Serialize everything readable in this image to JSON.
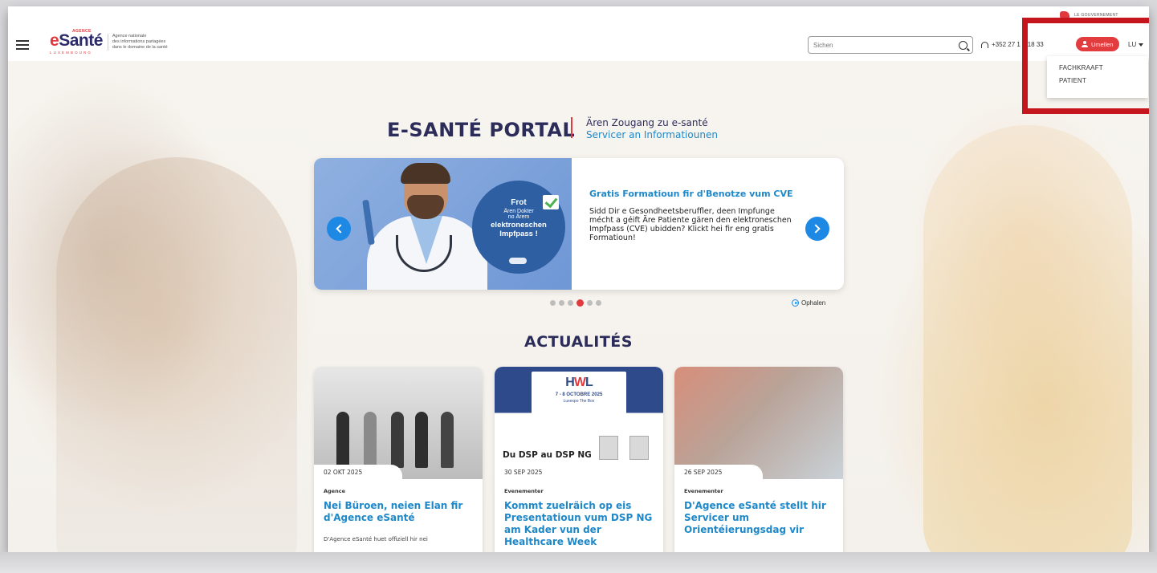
{
  "header": {
    "gov_label": "LE GOUVERNEMENT",
    "logo": {
      "agence": "AGENCE",
      "e": "e",
      "sante": "Santé",
      "country": "LUXEMBOURG",
      "tagline_1": "Agence nationale",
      "tagline_2": "des informations partagées",
      "tagline_3": "dans le domaine de la santé"
    },
    "search_placeholder": "Sichen",
    "phone": "+352 27 1 0 18 33",
    "login_label": "Umellen",
    "language": "LU"
  },
  "login_dropdown": {
    "items": [
      "FACHKRAAFT",
      "PATIENT"
    ]
  },
  "portal": {
    "title": "E-SANTÉ PORTAL",
    "subtitle_1": "Ären Zougang zu e-santé",
    "subtitle_2": "Servicer an Informatiounen"
  },
  "carousel": {
    "badge": {
      "line1": "Frot",
      "line2": "Ären Dokter",
      "line3": "no Ärem",
      "line4": "elektroneschen",
      "line5": "Impfpass !"
    },
    "slide_title": "Gratis Formatioun fir d'Benotze vum CVE",
    "slide_body": "Sidd Dir e Gesondheetsberuffler, deen Impfunge mécht a géift Äre Patiente gären den elektroneschen Impfpass (CVE) ubidden? Klickt hei fir eng gratis Formatioun!",
    "pause_label": "Ophalen",
    "dots_total": 6,
    "active_dot": 4
  },
  "news": {
    "title": "ACTUALITÉS",
    "cards": [
      {
        "date": "02 OKT 2025",
        "category": "Agence",
        "headline": "Nei Büroen, neien Elan fir d'Agence eSanté",
        "excerpt": "D'Agence eSanté huet offiziell hir nei"
      },
      {
        "date": "30 SEP 2025",
        "category": "Evenementer",
        "headline": "Kommt zuelräich op eis Presentatioun vum DSP NG am Kader vun der Healthcare Week",
        "banner": {
          "logo_h": "H",
          "logo_w": "W",
          "logo_l": "L",
          "dates": "7 - 8 OCTOBRE 2025",
          "venue": "Luxexpo The Box",
          "subtitle": "Du DSP au DSP NG"
        }
      },
      {
        "date": "26 SEP 2025",
        "category": "Evenementer",
        "headline": "D'Agence eSanté stellt hir Servicer um Orientéierungsdag vir"
      }
    ]
  },
  "colors": {
    "brand_red": "#e03a3e",
    "brand_navy": "#2c2c5a",
    "accent_blue": "#1e88c8",
    "highlight_red": "#c4161c"
  }
}
